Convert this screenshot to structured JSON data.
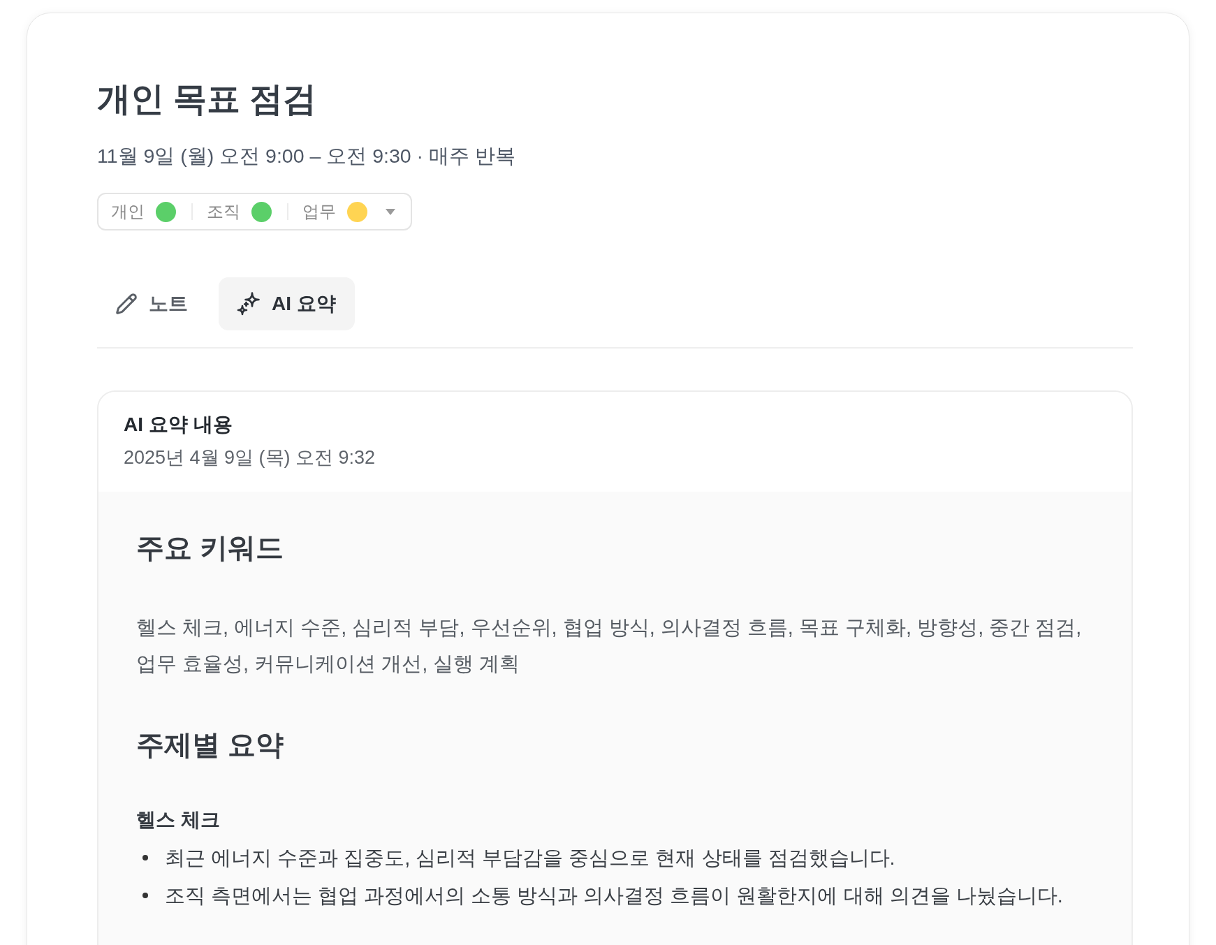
{
  "event": {
    "title": "개인 목표 점검",
    "schedule": "11월 9일 (월) 오전 9:00 – 오전 9:30 · 매주 반복"
  },
  "tags": {
    "items": [
      {
        "label": "개인",
        "color": "#5bcf69"
      },
      {
        "label": "조직",
        "color": "#5bcf69"
      },
      {
        "label": "업무",
        "color": "#ffd452"
      }
    ]
  },
  "tabs": [
    {
      "label": "노트",
      "kind": "note",
      "selected": false
    },
    {
      "label": "AI 요약",
      "kind": "ai",
      "selected": true
    }
  ],
  "summary": {
    "title": "AI 요약 내용",
    "timestamp": "2025년 4월 9일 (목) 오전 9:32",
    "sections": [
      {
        "kind": "keywords",
        "heading": "주요 키워드",
        "text": "헬스 체크, 에너지 수준, 심리적 부담, 우선순위, 협업 방식, 의사결정 흐름, 목표 구체화, 방향성, 중간 점검, 업무 효율성, 커뮤니케이션 개선, 실행 계획"
      },
      {
        "kind": "topics",
        "heading": "주제별 요약",
        "topics": [
          {
            "title": "헬스 체크",
            "bullets": [
              "최근 에너지 수준과 집중도, 심리적 부담감을 중심으로 현재 상태를 점검했습니다.",
              "조직 측면에서는 협업 과정에서의 소통 방식과 의사결정 흐름이 원활한지에 대해 의견을 나눴습니다."
            ]
          }
        ]
      }
    ]
  }
}
